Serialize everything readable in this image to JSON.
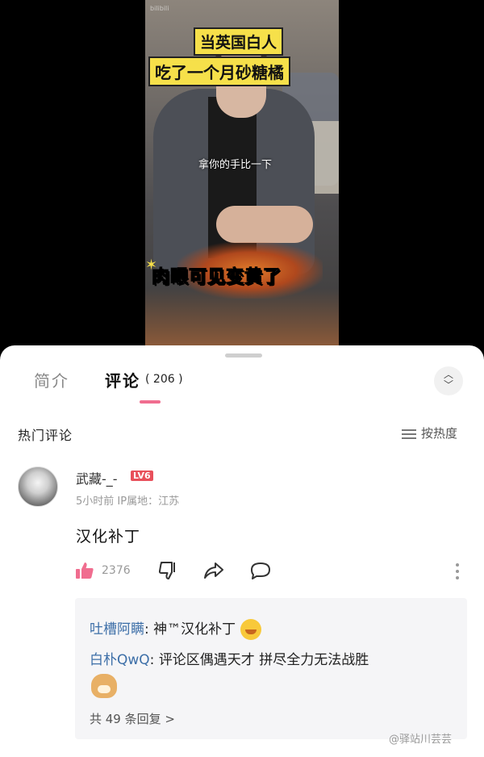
{
  "video": {
    "watermark": "bilibili",
    "title_line1": "当英国白人",
    "title_line2": "吃了一个月砂糖橘",
    "caption": "拿你的手比一下",
    "big_caption": "肉眼可见变黄了"
  },
  "tabs": {
    "intro": "简介",
    "comments": "评论",
    "comment_count": "( 206 )"
  },
  "hot_comments_label": "热门评论",
  "sort_label": "按热度",
  "comment": {
    "username": "武藏-_-",
    "level": "LV6",
    "meta": "5小时前 IP属地：江苏",
    "text": "汉化补丁",
    "like_count": "2376"
  },
  "replies": [
    {
      "name": "吐槽阿瞒",
      "text": "神™汉化补丁"
    },
    {
      "name": "白朴QwQ",
      "text": "评论区偶遇天才 拼尽全力无法战胜"
    }
  ],
  "replies_more": "共 49 条回复 >",
  "weibo_watermark": "@驿站川芸芸",
  "icons": {
    "like": "thumbs-up-icon",
    "dislike": "thumbs-down-icon",
    "share": "share-icon",
    "reply": "reply-bubble-icon",
    "more": "more-vertical-icon",
    "sort": "sort-lines-icon",
    "expand": "expand-collapse-icon"
  },
  "colors": {
    "accent_pink": "#f06d8f",
    "like_pink": "#f06d8f",
    "level_badge": "#e8505b",
    "reply_name_blue": "#3d6fa8",
    "title_yellow": "#f6e04a"
  }
}
